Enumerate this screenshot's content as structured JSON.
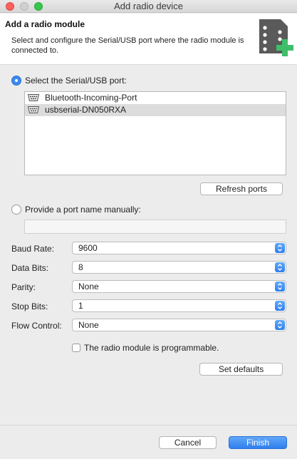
{
  "window": {
    "title": "Add radio device"
  },
  "header": {
    "title": "Add a radio module",
    "description": "Select and configure the Serial/USB port where the radio module is connected to.",
    "icon": "radio-module-add-icon"
  },
  "serial": {
    "option_label": "Select the Serial/USB port:",
    "selected": true,
    "ports": [
      {
        "label": "Bluetooth-Incoming-Port",
        "selected": false
      },
      {
        "label": "usbserial-DN050RXA",
        "selected": true
      }
    ],
    "refresh_label": "Refresh ports"
  },
  "manual": {
    "option_label": "Provide a port name manually:",
    "selected": false,
    "value": ""
  },
  "settings": {
    "baud_rate": {
      "label": "Baud Rate:",
      "value": "9600"
    },
    "data_bits": {
      "label": "Data Bits:",
      "value": "8"
    },
    "parity": {
      "label": "Parity:",
      "value": "None"
    },
    "stop_bits": {
      "label": "Stop Bits:",
      "value": "1"
    },
    "flow_control": {
      "label": "Flow Control:",
      "value": "None"
    }
  },
  "programmable": {
    "label": "The radio module is programmable.",
    "checked": false
  },
  "set_defaults_label": "Set defaults",
  "footer": {
    "cancel_label": "Cancel",
    "finish_label": "Finish"
  },
  "colors": {
    "accent": "#3b89f0",
    "icon_gray": "#5a5a5a",
    "icon_plus": "#3fbf6a"
  }
}
